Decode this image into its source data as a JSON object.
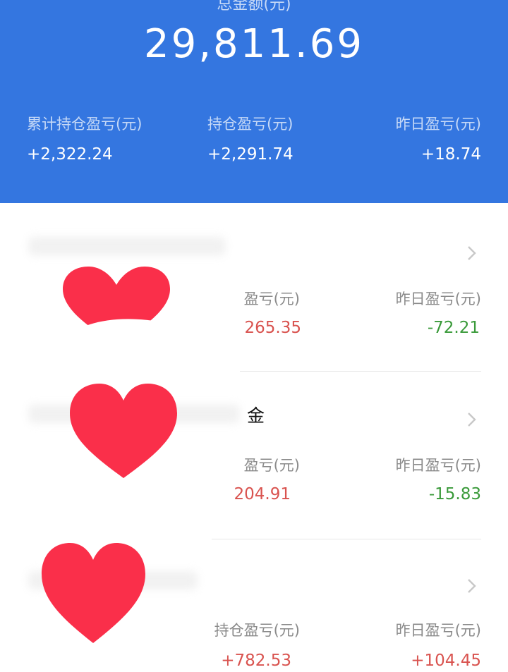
{
  "colors": {
    "accent": "#3476e0",
    "positive": "#d9534f",
    "negative": "#3a9a3a",
    "heart": "#fa2f4a"
  },
  "summary": {
    "total_label": "总金额(元)",
    "total_amount": "29,811.69",
    "stats": [
      {
        "label": "累计持仓盈亏(元)",
        "value": "+2,322.24"
      },
      {
        "label": "持仓盈亏(元)",
        "value": "+2,291.74"
      },
      {
        "label": "昨日盈亏(元)",
        "value": "+18.74"
      }
    ]
  },
  "funds": [
    {
      "name": "",
      "pl_label": "盈亏(元)",
      "pl_value": "265.35",
      "pl_sign": "positive",
      "yday_label": "昨日盈亏(元)",
      "yday_value": "-72.21",
      "yday_sign": "negative",
      "icon": "heart-sticker-icon"
    },
    {
      "name": "金",
      "pl_label": "盈亏(元)",
      "pl_value": "204.91",
      "pl_sign": "positive",
      "yday_label": "昨日盈亏(元)",
      "yday_value": "-15.83",
      "yday_sign": "negative",
      "icon": "heart-sticker-icon"
    },
    {
      "name": "",
      "pl_label": "持仓盈亏(元)",
      "pl_value": "+782.53",
      "pl_sign": "positive",
      "yday_label": "昨日盈亏(元)",
      "yday_value": "+104.45",
      "yday_sign": "positive",
      "icon": "heart-sticker-icon"
    }
  ],
  "chevron_icon": "chevron-right-icon"
}
